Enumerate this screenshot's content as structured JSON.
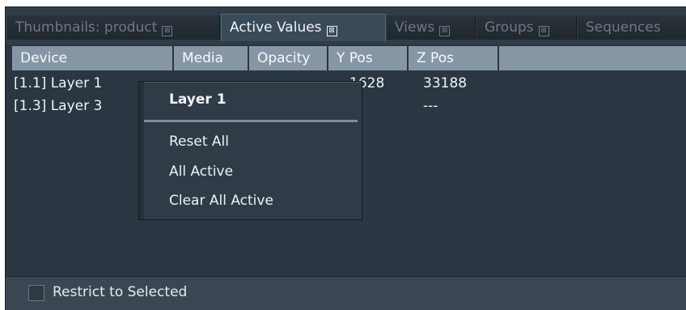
{
  "tabs": [
    {
      "label": "Thumbnails: product",
      "active": false
    },
    {
      "label": "Active Values",
      "active": true
    },
    {
      "label": "Views",
      "active": false
    },
    {
      "label": "Groups",
      "active": false
    },
    {
      "label": "Sequences",
      "active": false
    }
  ],
  "close_glyph": "⊠",
  "table": {
    "headers": [
      "Device",
      "Media",
      "Opacity",
      "Y Pos",
      "Z Pos"
    ],
    "rows": [
      {
        "device": "[1.1] Layer 1",
        "y_pos": "1628",
        "z_pos": "33188"
      },
      {
        "device": "[1.3] Layer 3",
        "z_pos": "---"
      }
    ]
  },
  "context_menu": {
    "title": "Layer 1",
    "items": [
      "Reset All",
      "All Active",
      "Clear All Active"
    ]
  },
  "footer": {
    "restrict_label": "Restrict to Selected",
    "restrict_checked": false
  },
  "colors": {
    "panel_bg": "#2a3641",
    "header_bg": "#8796a5",
    "menu_bg": "#2f3c48",
    "active_tab_bg": "#3a4a57"
  }
}
